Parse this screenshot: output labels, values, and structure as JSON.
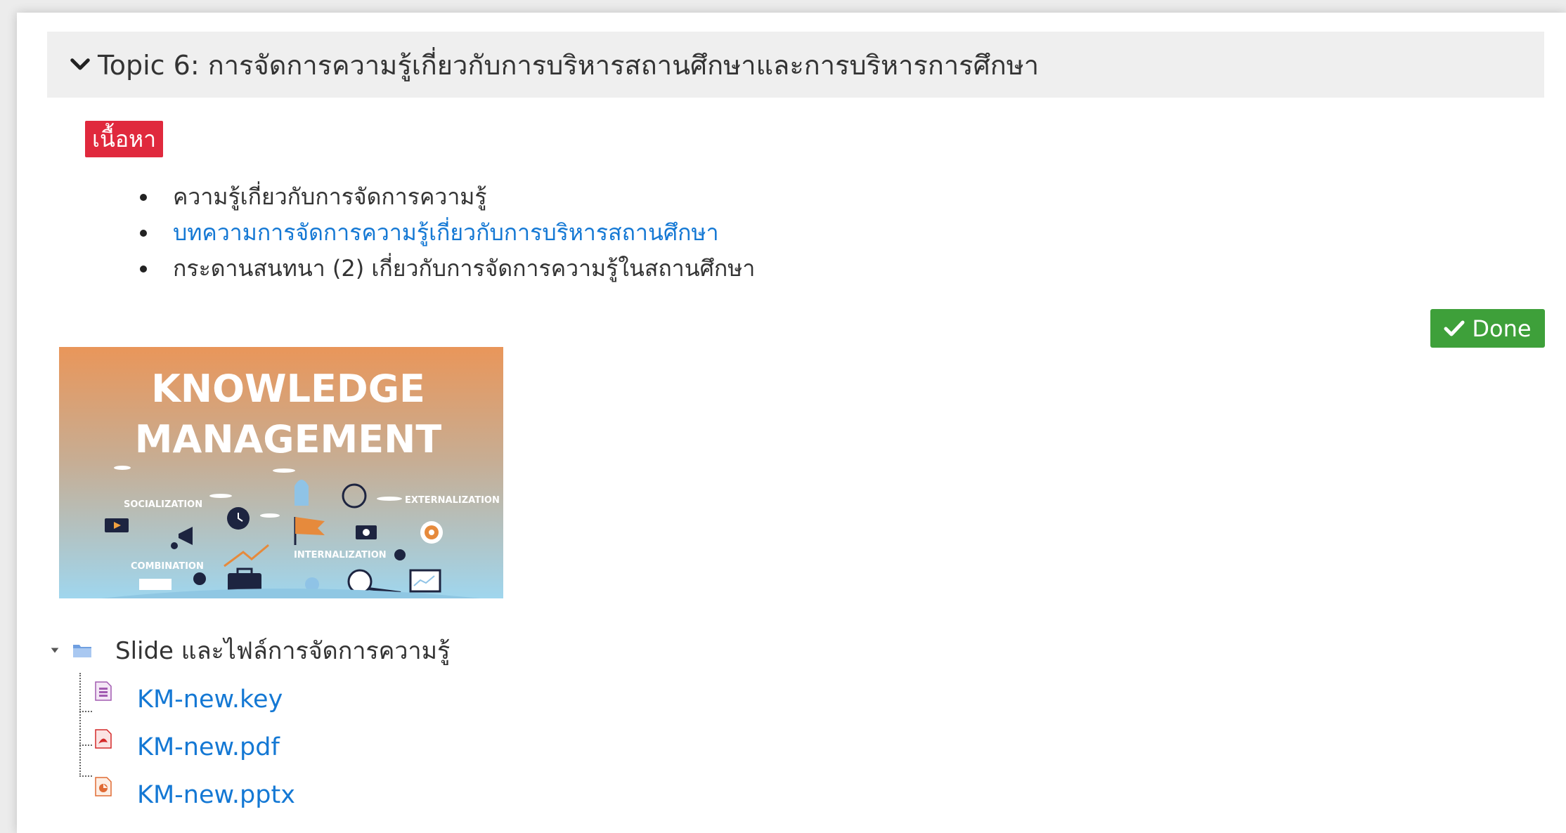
{
  "topic": {
    "title": "Topic 6: การจัดการความรู้เกี่ยวกับการบริหารสถานศึกษาและการบริหารการศึกษา"
  },
  "content_badge": "เนื้อหา",
  "content_items": [
    {
      "label": "ความรู้เกี่ยวกับการจัดการความรู้",
      "is_link": false
    },
    {
      "label": "บทความการจัดการความรู้เกี่ยวกับการบริหารสถานศึกษา",
      "is_link": true
    },
    {
      "label": "กระดานสนทนา (2) เกี่ยวกับการจัดการความรู้ในสถานศึกษา",
      "is_link": false
    }
  ],
  "done_button": {
    "label": "Done"
  },
  "banner": {
    "title_line1": "KNOWLEDGE",
    "title_line2": "MANAGEMENT",
    "label_socialization": "SOCIALIZATION",
    "label_externalization": "EXTERNALIZATION",
    "label_internalization": "INTERNALIZATION",
    "label_combination": "COMBINATION"
  },
  "folder": {
    "name": "Slide และไฟล์การจัดการความรู้",
    "files": [
      {
        "name": "KM-new.key",
        "icon": "keynote-file-icon"
      },
      {
        "name": "KM-new.pdf",
        "icon": "pdf-file-icon"
      },
      {
        "name": "KM-new.pptx",
        "icon": "powerpoint-file-icon"
      }
    ]
  },
  "colors": {
    "link": "#1478d4",
    "badge": "#e0293d",
    "done": "#3ea03a",
    "header_bg": "#efefef"
  }
}
